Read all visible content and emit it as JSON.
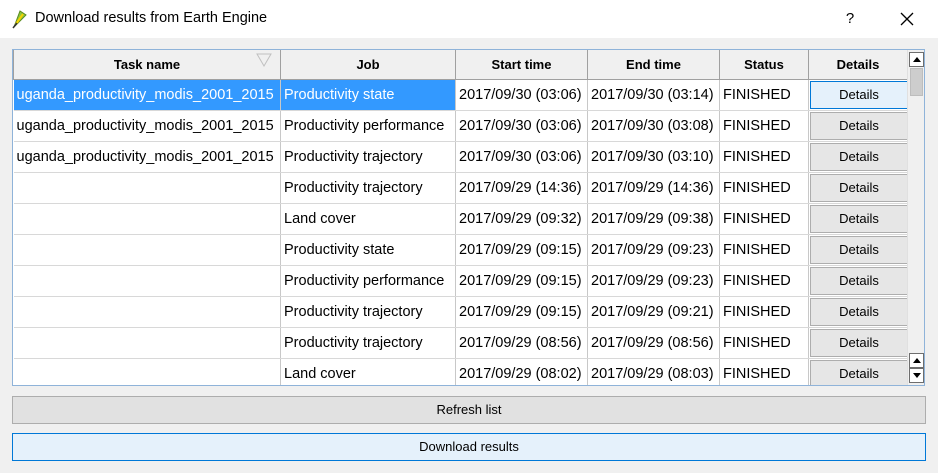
{
  "window": {
    "title": "Download results from Earth Engine",
    "help_label": "?",
    "icon": "qgis-logo-icon"
  },
  "table": {
    "columns": [
      "Task name",
      "Job",
      "Start time",
      "End time",
      "Status",
      "Details"
    ],
    "rows": [
      {
        "task": "uganda_productivity_modis_2001_2015",
        "job": "Productivity state",
        "start": "2017/09/30 (03:06)",
        "end": "2017/09/30 (03:14)",
        "status": "FINISHED",
        "details": "Details"
      },
      {
        "task": "uganda_productivity_modis_2001_2015",
        "job": "Productivity performance",
        "start": "2017/09/30 (03:06)",
        "end": "2017/09/30 (03:08)",
        "status": "FINISHED",
        "details": "Details"
      },
      {
        "task": "uganda_productivity_modis_2001_2015",
        "job": "Productivity trajectory",
        "start": "2017/09/30 (03:06)",
        "end": "2017/09/30 (03:10)",
        "status": "FINISHED",
        "details": "Details"
      },
      {
        "task": "",
        "job": "Productivity trajectory",
        "start": "2017/09/29 (14:36)",
        "end": "2017/09/29 (14:36)",
        "status": "FINISHED",
        "details": "Details"
      },
      {
        "task": "",
        "job": "Land cover",
        "start": "2017/09/29 (09:32)",
        "end": "2017/09/29 (09:38)",
        "status": "FINISHED",
        "details": "Details"
      },
      {
        "task": "",
        "job": "Productivity state",
        "start": "2017/09/29 (09:15)",
        "end": "2017/09/29 (09:23)",
        "status": "FINISHED",
        "details": "Details"
      },
      {
        "task": "",
        "job": "Productivity performance",
        "start": "2017/09/29 (09:15)",
        "end": "2017/09/29 (09:23)",
        "status": "FINISHED",
        "details": "Details"
      },
      {
        "task": "",
        "job": "Productivity trajectory",
        "start": "2017/09/29 (09:15)",
        "end": "2017/09/29 (09:21)",
        "status": "FINISHED",
        "details": "Details"
      },
      {
        "task": "",
        "job": "Productivity trajectory",
        "start": "2017/09/29 (08:56)",
        "end": "2017/09/29 (08:56)",
        "status": "FINISHED",
        "details": "Details"
      },
      {
        "task": "",
        "job": "Land cover",
        "start": "2017/09/29 (08:02)",
        "end": "2017/09/29 (08:03)",
        "status": "FINISHED",
        "details": "Details"
      }
    ],
    "selected_row": 0
  },
  "buttons": {
    "refresh": "Refresh list",
    "download": "Download results"
  },
  "colors": {
    "selection": "#3399ff",
    "focus_border": "#0078d7"
  }
}
